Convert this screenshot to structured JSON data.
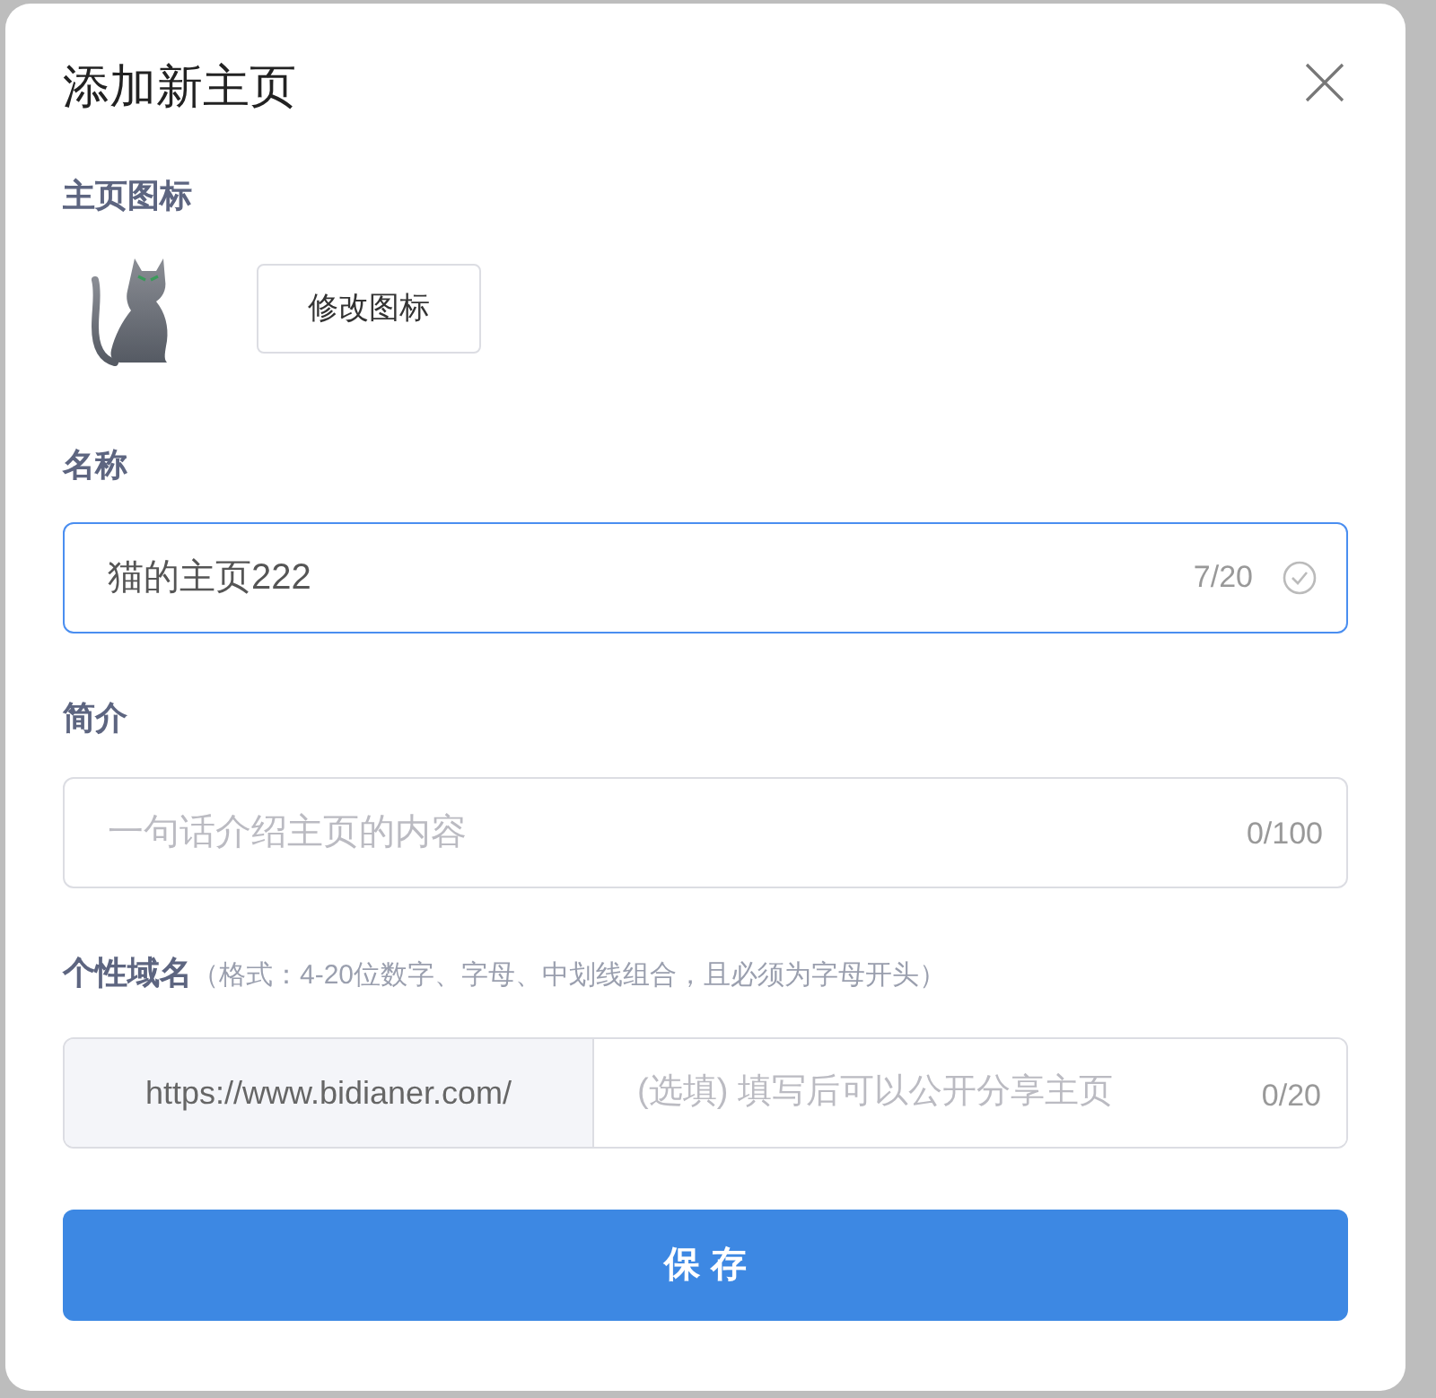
{
  "dialog": {
    "title": "添加新主页"
  },
  "icon_section": {
    "label": "主页图标",
    "button": "修改图标"
  },
  "name_field": {
    "label": "名称",
    "value": "猫的主页222",
    "counter": "7/20",
    "focused": true,
    "valid": true
  },
  "intro_field": {
    "label": "简介",
    "placeholder": "一句话介绍主页的内容",
    "counter": "0/100"
  },
  "domain_field": {
    "label": "个性域名",
    "hint": "（格式：4-20位数字、字母、中划线组合，且必须为字母开头）",
    "prefix": "https://www.bidianer.com/",
    "placeholder": "(选填) 填写后可以公开分享主页",
    "counter": "0/20"
  },
  "save_button": "保 存"
}
